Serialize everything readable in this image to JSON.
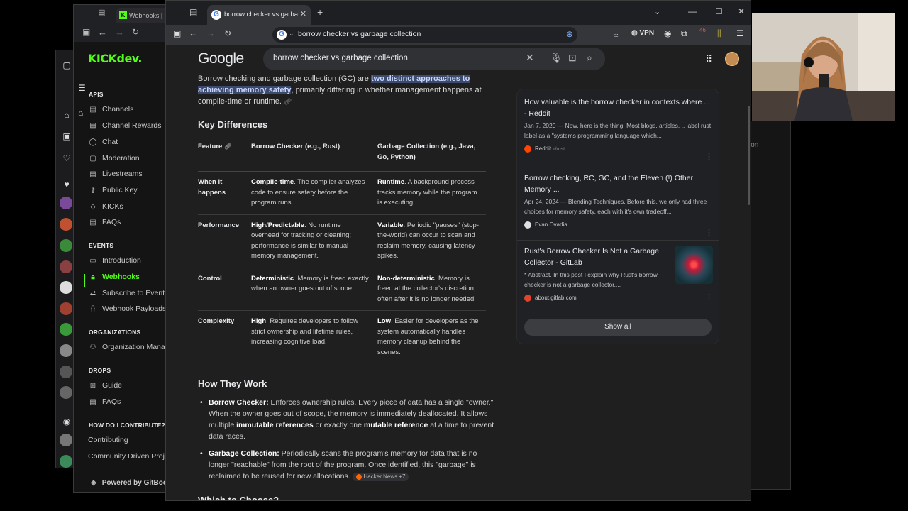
{
  "kick": {
    "tab_title": "Webhooks | Ki",
    "logo": "KICK",
    "logo_suffix": "dev.",
    "sections": {
      "apis": "APIS",
      "events": "EVENTS",
      "organizations": "ORGANIZATIONS",
      "drops": "DROPS",
      "contribute": "HOW DO I CONTRIBUTE?"
    },
    "items": {
      "channels": "Channels",
      "channel_rewards": "Channel Rewards",
      "chat": "Chat",
      "moderation": "Moderation",
      "livestreams": "Livestreams",
      "public_key": "Public Key",
      "kicks": "KICKs",
      "faqs": "FAQs",
      "introduction": "Introduction",
      "webhooks": "Webhooks",
      "subscribe": "Subscribe to Events",
      "payloads": "Webhook Payloads",
      "org_manage": "Organization Manag",
      "guide": "Guide",
      "drops_faqs": "FAQs",
      "contributing": "Contributing",
      "community": "Community Driven Proje"
    },
    "footer": "Powered by GitBook"
  },
  "back_window_label": "ion",
  "browser": {
    "tab_title": "borrow checker vs garbage colle",
    "url": "borrow checker vs garbage collection",
    "vpn": "VPN",
    "badge": "46"
  },
  "search": {
    "logo": "Google",
    "query": "borrow checker vs garbage collection"
  },
  "answer": {
    "intro_pre": "Borrow checking and garbage collection (GC) are ",
    "intro_hl": "two distinct approaches to achieving memory safety",
    "intro_post": ", primarily differing in whether management happens at compile-time or runtime.",
    "key_diff": "Key Differences",
    "table": {
      "headers": [
        "Feature",
        "Borrow Checker (e.g., Rust)",
        "Garbage Collection (e.g., Java, Go, Python)"
      ],
      "rows": [
        {
          "feature": "When it happens",
          "bc_b": "Compile-time",
          "bc": ". The compiler analyzes code to ensure safety before the program runs.",
          "gc_b": "Runtime",
          "gc": ". A background process tracks memory while the program is executing."
        },
        {
          "feature": "Performance",
          "bc_b": "High/Predictable",
          "bc": ". No runtime overhead for tracking or cleaning; performance is similar to manual memory management.",
          "gc_b": "Variable",
          "gc": ". Periodic \"pauses\" (stop-the-world) can occur to scan and reclaim memory, causing latency spikes."
        },
        {
          "feature": "Control",
          "bc_b": "Deterministic",
          "bc": ". Memory is freed exactly when an owner goes out of scope.",
          "gc_b": "Non-deterministic",
          "gc": ". Memory is freed at the collector's discretion, often after it is no longer needed."
        },
        {
          "feature": "Complexity",
          "bc_b": "High",
          "bc": ". Requires developers to follow strict ownership and lifetime rules, increasing cognitive load.",
          "gc_b": "Low",
          "gc": ". Easier for developers as the system automatically handles memory cleanup behind the scenes."
        }
      ]
    },
    "how_title": "How They Work",
    "bc_item": {
      "label": "Borrow Checker:",
      "t1": " Enforces ownership rules. Every piece of data has a single \"owner.\" When the owner goes out of scope, the memory is immediately deallocated. It allows multiple ",
      "b1": "immutable references",
      "t2": " or exactly one ",
      "b2": "mutable reference",
      "t3": " at a time to prevent data races."
    },
    "gc_item": {
      "label": "Garbage Collection:",
      "t1": " Periodically scans the program's memory for data that is no longer \"reachable\" from the root of the program. Once identified, this \"garbage\" is reclaimed to be reused for new allocations. ",
      "chip": "Hacker News +7"
    },
    "which_title": "Which to Choose?"
  },
  "sources": [
    {
      "title": "How valuable is the borrow checker in contexts where ... - Reddit",
      "snippet": "Jan 7, 2020 — Now, here is the thing: Most blogs, articles, .. label rust label as a \"systems programming language which...",
      "site": "Reddit",
      "sub": "r/rust",
      "color": "#ff4500"
    },
    {
      "title": "Borrow checking, RC, GC, and the Eleven (!) Other Memory ...",
      "snippet": "Apr 24, 2024 — Blending Techniques. Before this, we only had three choices for memory safety, each with it's own tradeoff...",
      "site": "Evan Ovadia",
      "sub": "",
      "color": "#e0e0e0"
    },
    {
      "title": "Rust's Borrow Checker Is Not a Garbage Collector - GitLab",
      "snippet": "* Abstract. In this post I explain why Rust's borrow checker is not a garbage collector....",
      "site": "about.gitlab.com",
      "sub": "",
      "color": "#e24329"
    }
  ],
  "show_all": "Show all"
}
